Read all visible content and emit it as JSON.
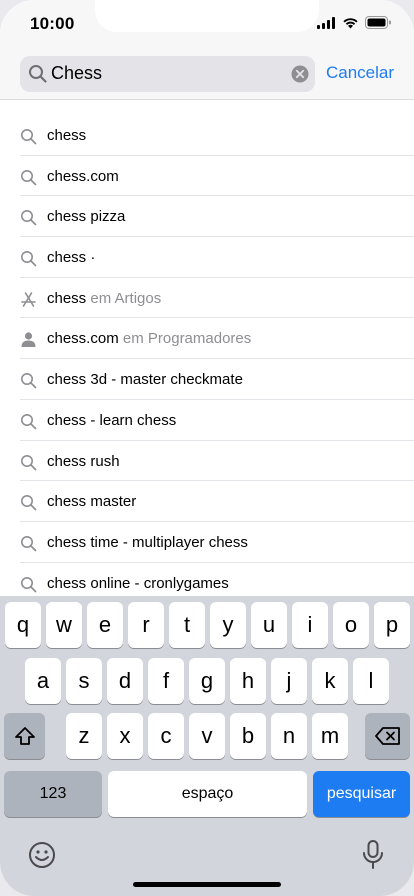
{
  "status_bar": {
    "time": "10:00"
  },
  "search": {
    "value": "Chess",
    "cancel_label": "Cancelar"
  },
  "suggestions": [
    {
      "icon": "search-icon",
      "text": "chess",
      "suffix": ""
    },
    {
      "icon": "search-icon",
      "text": "chess.com",
      "suffix": ""
    },
    {
      "icon": "search-icon",
      "text": "chess pizza",
      "suffix": ""
    },
    {
      "icon": "search-icon",
      "text": "chess ·",
      "suffix": ""
    },
    {
      "icon": "app-store-icon",
      "text": "chess",
      "suffix": "em Artigos"
    },
    {
      "icon": "person-icon",
      "text": "chess.com",
      "suffix": "em Programadores"
    },
    {
      "icon": "search-icon",
      "text": "chess 3d - master checkmate",
      "suffix": ""
    },
    {
      "icon": "search-icon",
      "text": "chess - learn chess",
      "suffix": ""
    },
    {
      "icon": "search-icon",
      "text": "chess rush",
      "suffix": ""
    },
    {
      "icon": "search-icon",
      "text": "chess master",
      "suffix": ""
    },
    {
      "icon": "search-icon",
      "text": "chess time - multiplayer chess",
      "suffix": ""
    },
    {
      "icon": "search-icon",
      "text": "chess online - cronlygames",
      "suffix": ""
    }
  ],
  "keyboard": {
    "row1": [
      "q",
      "w",
      "e",
      "r",
      "t",
      "y",
      "u",
      "i",
      "o",
      "p"
    ],
    "row2": [
      "a",
      "s",
      "d",
      "f",
      "g",
      "h",
      "j",
      "k",
      "l"
    ],
    "row3": [
      "z",
      "x",
      "c",
      "v",
      "b",
      "n",
      "m"
    ],
    "numbers_label": "123",
    "space_label": "espaço",
    "search_label": "pesquisar"
  },
  "colors": {
    "accent": "#1e7cf2",
    "secondary_text": "#8e8e93"
  }
}
